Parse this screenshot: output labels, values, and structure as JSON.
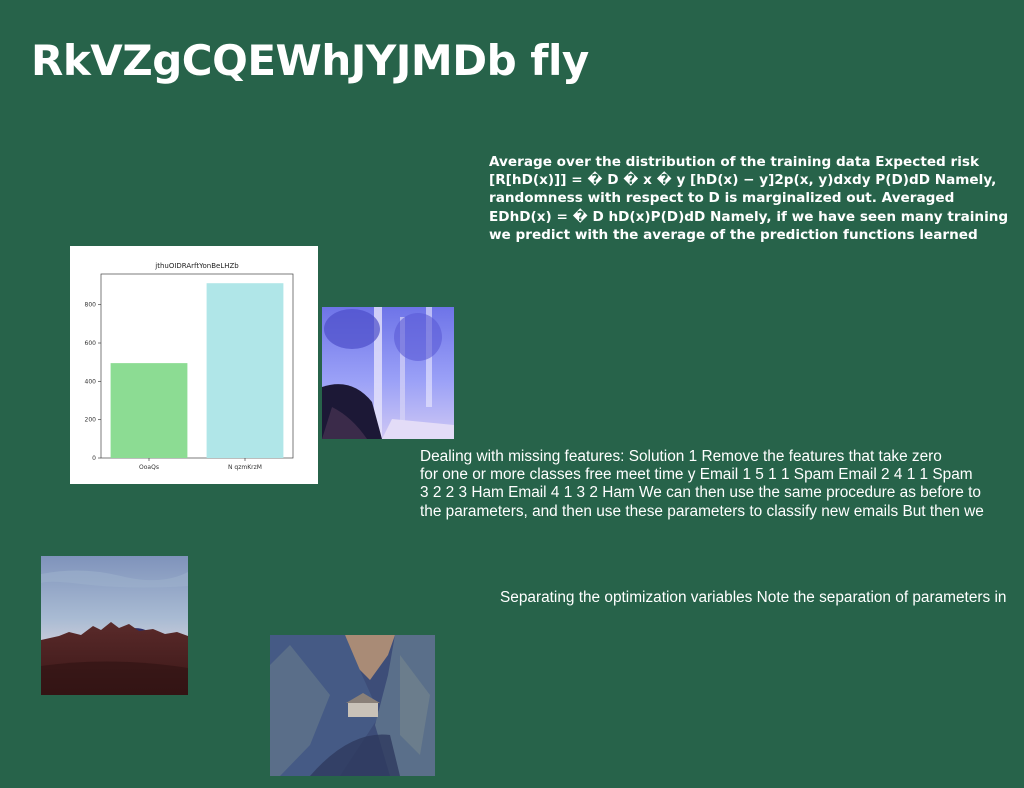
{
  "page": {
    "title": "RkVZgCQEWhJYJMDb fly",
    "background": "#27634a"
  },
  "paragraphs": {
    "expected_risk": [
      "Average over the distribution of the training data Expected risk",
      "[R[hD(x)]] = � D � x � y [hD(x) − y]2p(x, y)dxdy P(D)dD Namely,",
      "randomness with respect to D is marginalized out. Averaged",
      "EDhD(x) = � D hD(x)P(D)dD Namely, if we have seen many training",
      "we predict with the average of the prediction functions learned"
    ],
    "missing_features": [
      "Dealing with missing features: Solution 1 Remove the features that take zero",
      "for one or more classes free meet time y Email 1 5 1 1 Spam Email 2 4 1 1 Spam",
      "3 2 2 3 Ham Email 4 1 3 2 Ham We can then use the same procedure as before to",
      "the parameters, and then use these parameters to classify new emails But then we"
    ],
    "optimization": [
      "Separating the optimization variables Note the separation of parameters in"
    ]
  },
  "chart_data": {
    "type": "bar",
    "title": "jthuOIDRArftYonBeLHZb",
    "categories": [
      "OoaQs",
      "N qzmKrzM"
    ],
    "values": [
      495,
      912
    ],
    "colors": [
      "#8cdc93",
      "#b0e6e8"
    ],
    "yticks": [
      0,
      200,
      400,
      600,
      800
    ],
    "ylim": [
      0,
      960
    ],
    "xlabel": "",
    "ylabel": "",
    "grid": false
  },
  "images": {
    "forest": {
      "icon": "forest-photo",
      "colors": [
        "#7f86f2",
        "#1b1738",
        "#d9d0f5"
      ]
    },
    "mountain": {
      "icon": "mountain-photo",
      "colors": [
        "#8fa4c8",
        "#4d1f1e",
        "#2a2b53"
      ]
    },
    "valley": {
      "icon": "valley-photo",
      "colors": [
        "#3f4f80",
        "#a88a75",
        "#6b7e80"
      ]
    }
  }
}
